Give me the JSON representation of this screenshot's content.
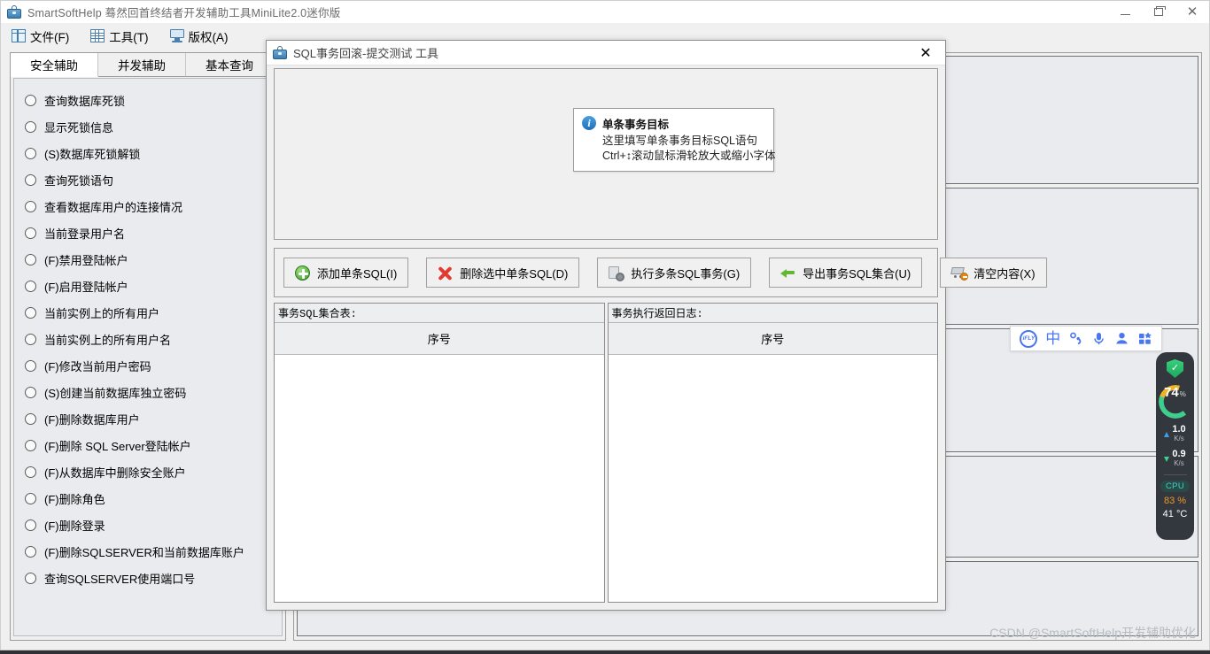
{
  "app": {
    "title": "SmartSoftHelp 蓦然回首终结者开发辅助工具MiniLite2.0迷你版",
    "icon": "briefcase-icon",
    "controls": {
      "minimize": "minimize",
      "maximize": "maximize",
      "close": "close"
    }
  },
  "menubar": {
    "items": [
      {
        "label": "文件(F)",
        "icon": "file-panes-icon"
      },
      {
        "label": "工具(T)",
        "icon": "grid-table-icon"
      },
      {
        "label": "版权(A)",
        "icon": "monitor-icon"
      }
    ]
  },
  "left_panel": {
    "tabs": [
      {
        "label": "安全辅助",
        "active": true
      },
      {
        "label": "并发辅助",
        "active": false
      },
      {
        "label": "基本查询",
        "active": false
      }
    ],
    "radio_items": [
      "查询数据库死锁",
      "显示死锁信息",
      "(S)数据库死锁解锁",
      "查询死锁语句",
      "查看数据库用户的连接情况",
      "当前登录用户名",
      "(F)禁用登陆帐户",
      "(F)启用登陆帐户",
      "当前实例上的所有用户",
      "当前实例上的所有用户名",
      "(F)修改当前用户密码",
      "(S)创建当前数据库独立密码",
      "(F)删除数据库用户",
      "(F)删除 SQL Server登陆帐户",
      "(F)从数据库中删除安全账户",
      "(F)删除角色",
      "(F)删除登录",
      "(F)删除SQLSERVER和当前数据库账户",
      "查询SQLSERVER使用端口号"
    ]
  },
  "dialog": {
    "title": "SQL事务回滚-提交测试 工具",
    "icon": "briefcase-icon",
    "controls": {
      "minimize": "minimize",
      "close": "close"
    },
    "tooltip": {
      "icon": "info-icon",
      "title": "单条事务目标",
      "line1": "这里填写单条事务目标SQL语句",
      "line2": "Ctrl+↕滚动鼠标滑轮放大或缩小字体"
    },
    "toolbar": [
      {
        "label": "添加单条SQL(I)",
        "icon": "add-circle-icon"
      },
      {
        "label": "删除选中单条SQL(D)",
        "icon": "delete-x-icon"
      },
      {
        "label": "执行多条SQL事务(G)",
        "icon": "run-gear-icon"
      },
      {
        "label": "导出事务SQL集合(U)",
        "icon": "export-arrow-icon"
      },
      {
        "label": "清空内容(X)",
        "icon": "clear-cart-icon"
      }
    ],
    "grids": [
      {
        "caption": "事务SQL集合表:",
        "columns": [
          "序号"
        ],
        "rows": []
      },
      {
        "caption": "事务执行返回日志:",
        "columns": [
          "序号"
        ],
        "rows": []
      }
    ]
  },
  "ime_bar": {
    "icons": [
      "ifly-logo-icon",
      "chinese-mode-icon",
      "punctuation-icon",
      "microphone-icon",
      "user-icon",
      "apps-grid-icon"
    ],
    "logo_text": "iFLY",
    "mode_text": "中"
  },
  "system_monitor": {
    "shield_status": "protected",
    "memory_percent": "74",
    "memory_unit": "%",
    "upload_speed": "1.0",
    "upload_unit": "K/s",
    "download_speed": "0.9",
    "download_unit": "K/s",
    "cpu_label": "CPU",
    "cpu_percent": "83 %",
    "cpu_temp": "41 °C",
    "colors": {
      "ring_green": "#3ecf8e",
      "ring_amber": "#f0b429",
      "cpu_chip": "#3fd0c9",
      "cpu_value": "#f0962b"
    }
  },
  "watermark": {
    "text": "CSDN @SmartSoftHelp开发辅助优化"
  }
}
